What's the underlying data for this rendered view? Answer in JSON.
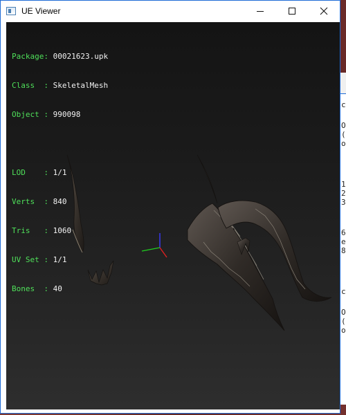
{
  "window": {
    "title": "UE Viewer",
    "controls": {
      "minimize": "minimize-icon",
      "maximize": "maximize-icon",
      "close": "close-icon"
    }
  },
  "info": {
    "package_key": "Package:",
    "package_value": "00021623.upk",
    "class_key": "Class  :",
    "class_value": "SkeletalMesh",
    "object_key": "Object :",
    "object_value": "990098",
    "lod_key": "LOD    :",
    "lod_value": "1/1",
    "verts_key": "Verts  :",
    "verts_value": "840",
    "tris_key": "Tris   :",
    "tris_value": "1060",
    "uvset_key": "UV Set :",
    "uvset_value": "1/1",
    "bones_key": "Bones  :",
    "bones_value": "40"
  },
  "colors": {
    "label": "#4fe05a",
    "value": "#f2f2f2",
    "axis_x": "#e02020",
    "axis_y": "#20d020",
    "axis_z": "#3a3aff",
    "window_border": "#1e6bd6"
  },
  "background_window": {
    "snippets": [
      "c",
      "O\n(\no",
      "1\n2\n3",
      "6\ne\n8",
      "c",
      "O\n(\no"
    ]
  }
}
